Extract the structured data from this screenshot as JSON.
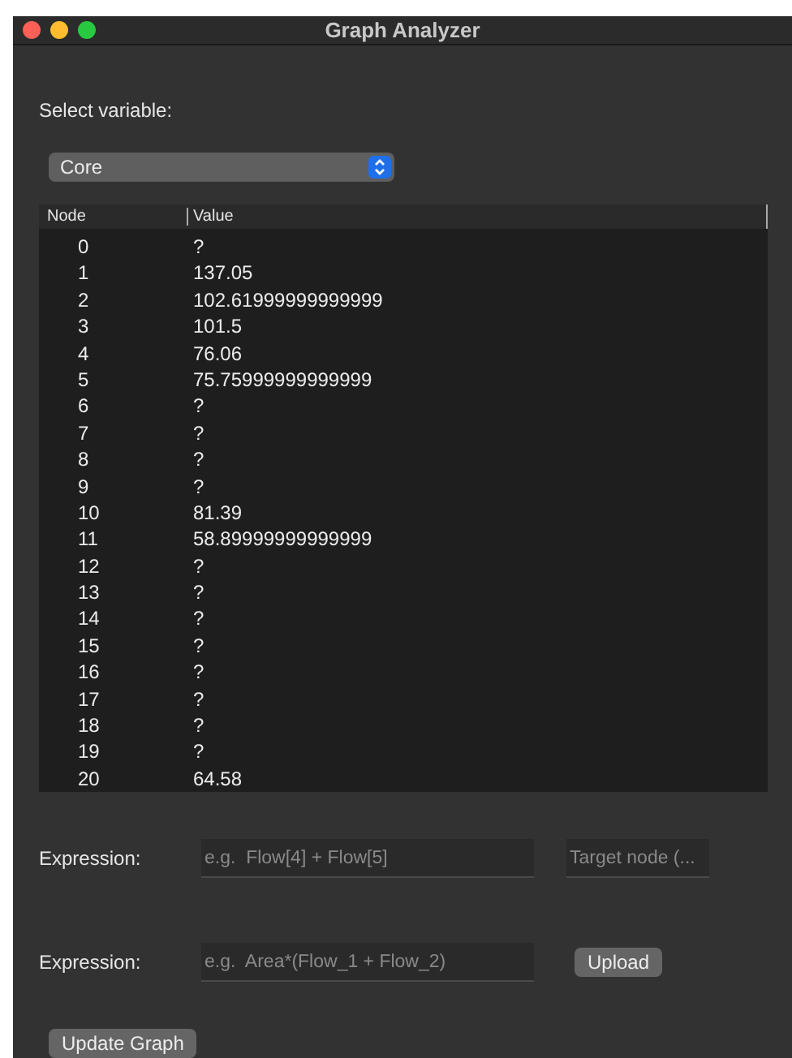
{
  "window": {
    "title": "Graph Analyzer"
  },
  "variable": {
    "label": "Select variable:",
    "value": "Core"
  },
  "table": {
    "columns": [
      "Node",
      "Value"
    ],
    "rows": [
      [
        "0",
        "?"
      ],
      [
        "1",
        "137.05"
      ],
      [
        "2",
        "102.61999999999999"
      ],
      [
        "3",
        "101.5"
      ],
      [
        "4",
        "76.06"
      ],
      [
        "5",
        "75.75999999999999"
      ],
      [
        "6",
        "?"
      ],
      [
        "7",
        "?"
      ],
      [
        "8",
        "?"
      ],
      [
        "9",
        "?"
      ],
      [
        "10",
        "81.39"
      ],
      [
        "11",
        "58.89999999999999"
      ],
      [
        "12",
        "?"
      ],
      [
        "13",
        "?"
      ],
      [
        "14",
        "?"
      ],
      [
        "15",
        "?"
      ],
      [
        "16",
        "?"
      ],
      [
        "17",
        "?"
      ],
      [
        "18",
        "?"
      ],
      [
        "19",
        "?"
      ],
      [
        "20",
        "64.58"
      ]
    ]
  },
  "expressions": [
    {
      "label": "Expression:",
      "placeholder": "e.g.  Flow[4] + Flow[5]",
      "kind": "field",
      "target_placeholder": "Target node (..."
    },
    {
      "label": "Expression:",
      "placeholder": "e.g.  Area*(Flow_1 + Flow_2)",
      "kind": "button",
      "button": "Upload"
    }
  ],
  "update_button": "Update Graph"
}
